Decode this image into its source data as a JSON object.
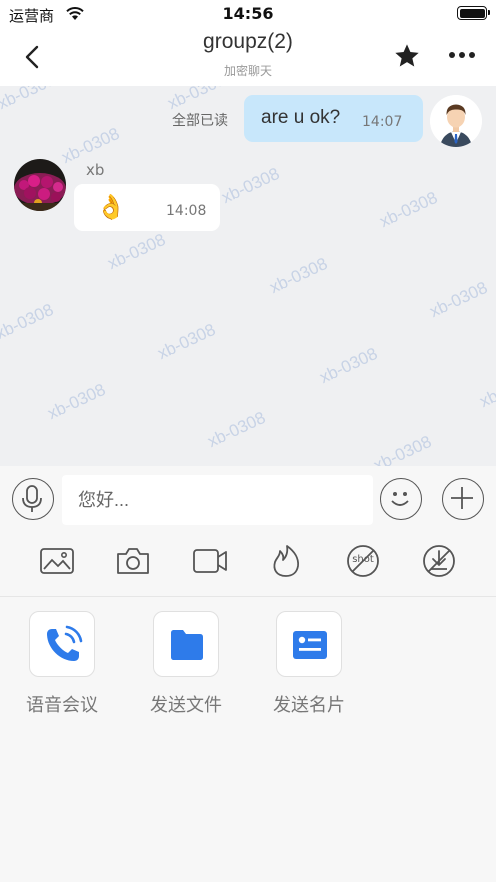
{
  "status_bar": {
    "carrier": "运营商",
    "time": "14:56"
  },
  "nav": {
    "title": "groupz(2)",
    "subtitle": "加密聊天",
    "icons": [
      "back-chevron-icon",
      "star-icon",
      "more-icon"
    ]
  },
  "watermark": "xb-0308",
  "messages": [
    {
      "direction": "outgoing",
      "read_status": "全部已读",
      "text": "are u ok?",
      "time": "14:07"
    },
    {
      "direction": "incoming",
      "sender": "xb",
      "text": "👌",
      "time": "14:08"
    }
  ],
  "composer": {
    "placeholder": "您好..."
  },
  "toolbar": [
    "image-icon",
    "camera-icon",
    "video-icon",
    "burn-after-reading-icon",
    "no-screenshot-icon",
    "withdraw-icon"
  ],
  "toolbar_no_shot_text": "shot",
  "actions": [
    {
      "label": "语音会议",
      "icon": "phone-icon"
    },
    {
      "label": "发送文件",
      "icon": "folder-icon"
    },
    {
      "label": "发送名片",
      "icon": "contact-card-icon"
    }
  ],
  "colors": {
    "accent": "#2e7bea",
    "outgoing_bubble": "#c8e7fb",
    "chat_bg": "#eff0f2",
    "watermark": "#c8d3e6"
  }
}
